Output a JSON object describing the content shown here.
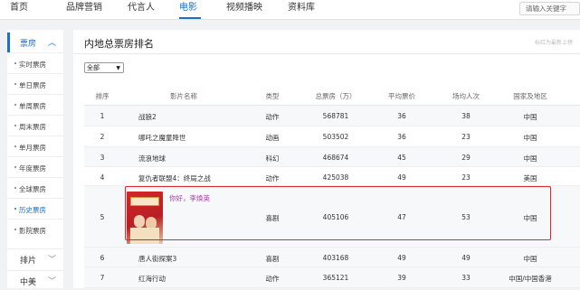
{
  "topnav": {
    "items": [
      "首页",
      "品牌营销",
      "代言人",
      "电影",
      "视频播映",
      "资料库"
    ],
    "active": "电影",
    "search_placeholder": "请输入关键字"
  },
  "sidebar": {
    "head": "票房",
    "items": [
      "实时票房",
      "单日票房",
      "单周票房",
      "周末票房",
      "单月票房",
      "年度票房",
      "全球票房",
      "历史票房",
      "影院票房"
    ],
    "active": "历史票房",
    "groups": [
      "排片",
      "中美"
    ]
  },
  "main": {
    "title": "内地总票房排名",
    "hint": "标红为最新上榜",
    "filter_value": "全部",
    "columns": [
      "排序",
      "影片名称",
      "类型",
      "总票房（万）",
      "平均票价",
      "场均人次",
      "国家及地区"
    ],
    "rows": [
      {
        "rank": "1",
        "name": "战狼2",
        "type": "动作",
        "box": "568781",
        "price": "36",
        "people": "38",
        "region": "中国"
      },
      {
        "rank": "2",
        "name": "哪吒之魔童降世",
        "type": "动画",
        "box": "503502",
        "price": "36",
        "people": "23",
        "region": "中国"
      },
      {
        "rank": "3",
        "name": "流浪地球",
        "type": "科幻",
        "box": "468674",
        "price": "45",
        "people": "29",
        "region": "中国"
      },
      {
        "rank": "4",
        "name": "复仇者联盟4：终局之战",
        "type": "动作",
        "box": "425038",
        "price": "49",
        "people": "23",
        "region": "美国"
      },
      {
        "rank": "5",
        "name": "你好，李焕英",
        "type": "喜剧",
        "box": "405106",
        "price": "47",
        "people": "53",
        "region": "中国"
      },
      {
        "rank": "6",
        "name": "唐人街探案3",
        "type": "喜剧",
        "box": "403168",
        "price": "49",
        "people": "49",
        "region": "中国"
      },
      {
        "rank": "7",
        "name": "红海行动",
        "type": "动作",
        "box": "365121",
        "price": "39",
        "people": "33",
        "region": "中国/中国香港"
      }
    ]
  },
  "colors": {
    "accent": "#1a6fc9",
    "highlight": "#e0282b",
    "film_link": "#a43da8"
  }
}
